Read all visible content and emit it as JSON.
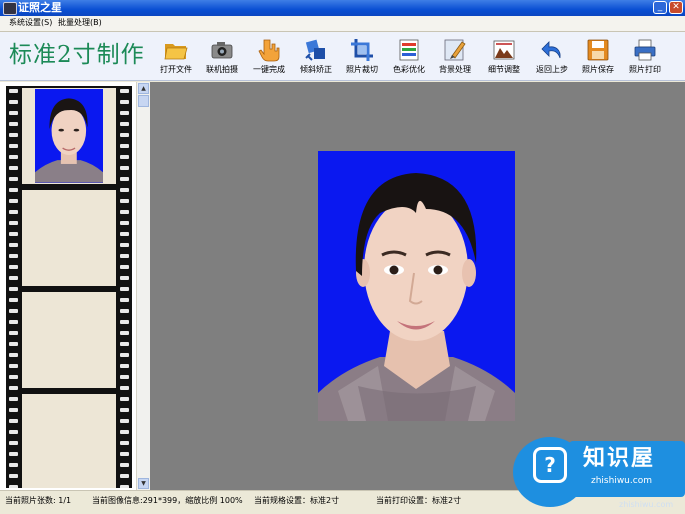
{
  "window": {
    "title": "证照之星"
  },
  "menu": [
    {
      "label": "系统设置(S)"
    },
    {
      "label": "批量处理(B)"
    }
  ],
  "app_title": "标准2寸制作",
  "toolbar": [
    {
      "label": "打开文件",
      "icon": "folder-open-icon"
    },
    {
      "label": "联机拍摄",
      "icon": "camera-icon"
    },
    {
      "label": "一键完成",
      "icon": "hand-pointer-icon"
    },
    {
      "label": "倾斜矫正",
      "icon": "tilt-correct-icon"
    },
    {
      "label": "照片裁切",
      "icon": "crop-icon"
    },
    {
      "label": "色彩优化",
      "icon": "color-bars-icon"
    },
    {
      "label": "背景处理",
      "icon": "background-brush-icon"
    },
    {
      "label": "细节调整",
      "icon": "detail-adjust-icon"
    },
    {
      "label": "返回上步",
      "icon": "undo-icon"
    },
    {
      "label": "照片保存",
      "icon": "save-disk-icon"
    },
    {
      "label": "照片打印",
      "icon": "printer-icon"
    }
  ],
  "status": {
    "count": "当前照片张数: 1/1",
    "image_info": "当前图像信息:291*399，缩放比例 100%",
    "spec": "当前规格设置：标准2寸",
    "print": "当前打印设置：标准2寸"
  },
  "watermark": {
    "brand": "知识屋",
    "domain": "zhishiwu.com",
    "url": "zhishiwu.com"
  },
  "colors": {
    "photo_background": "#0a18f0",
    "canvas": "#7f7f7f",
    "title_green": "#1c8a57",
    "titlebar_blue": "#0a4fd3"
  }
}
